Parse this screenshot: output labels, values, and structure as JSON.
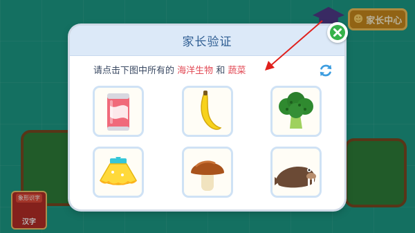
{
  "colors": {
    "accent_red": "#e24a55",
    "header_bg": "#dce9f8",
    "header_text": "#2f5e93",
    "close_green": "#35b24a",
    "refresh_blue": "#3d9de0",
    "annotation_arrow": "#e0201c"
  },
  "background": {
    "parent_center_label": "家长中心",
    "parent_center_icon": "parent-icon",
    "literacy_badge_top": "象形识字",
    "literacy_badge_bottom": "汉字"
  },
  "dialog": {
    "title": "家长验证",
    "instruction_prefix": "请点击下图中所有的",
    "target_a": "海洋生物",
    "joiner": "和",
    "target_b": "蔬菜",
    "close_icon": "close-icon",
    "refresh_icon": "refresh-icon",
    "choices": [
      {
        "icon": "soda-can-icon"
      },
      {
        "icon": "banana-icon"
      },
      {
        "icon": "broccoli-icon"
      },
      {
        "icon": "tutu-skirt-icon"
      },
      {
        "icon": "mushroom-icon"
      },
      {
        "icon": "walrus-icon"
      }
    ]
  }
}
